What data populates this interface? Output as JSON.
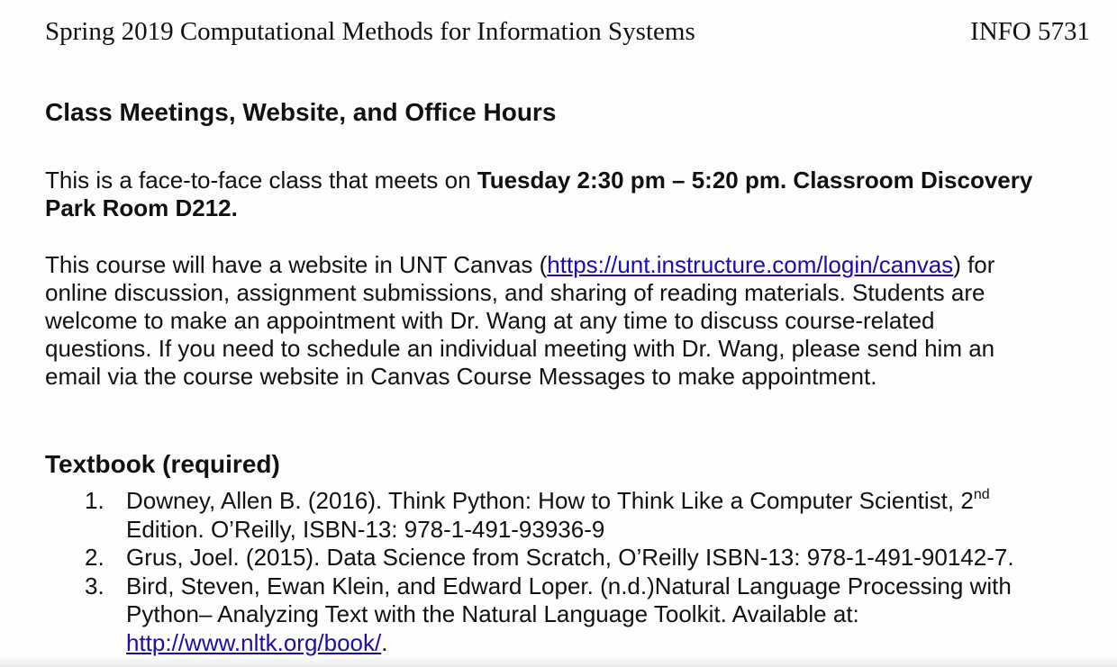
{
  "header": {
    "left": "Spring 2019 Computational Methods for Information Systems",
    "right": "INFO 5731"
  },
  "section_meetings": {
    "heading": "Class Meetings, Website, and Office Hours",
    "p1_lead": "This is a face-to-face class that meets on ",
    "p1_bold_a": "Tuesday 2:30 pm – 5:20 pm. Classroom Discovery",
    "p1_bold_b": "Park Room D212.",
    "p2_start": "This course will have a website in UNT Canvas (",
    "p2_link": "https://unt.instructure.com/login/canvas",
    "p2_after_link": ") for",
    "p2_line2": "online discussion, assignment submissions, and sharing of reading materials. Students are",
    "p2_line3": "welcome to make an appointment with Dr. Wang at any time to discuss course-related",
    "p2_line4": "questions. If you need to schedule an individual meeting with Dr. Wang, please send him an",
    "p2_line5": "email via the course website in Canvas Course Messages to make appointment."
  },
  "section_textbook": {
    "heading": "Textbook (required)",
    "items": [
      {
        "num": "1.",
        "line1": "Downey, Allen B. (2016). Think Python: How to Think Like a Computer Scientist, 2",
        "sup": "nd",
        "line2": "Edition.  O’Reilly, ISBN-13: 978-1-491-93936-9"
      },
      {
        "num": "2.",
        "line1": "Grus, Joel. (2015). Data Science from Scratch, O’Reilly ISBN-13: 978-1-491-90142-7."
      },
      {
        "num": "3.",
        "line1": "Bird, Steven, Ewan Klein, and Edward Loper. (n.d.)Natural Language Processing with",
        "line2": "Python– Analyzing Text with the Natural Language Toolkit. Available at:",
        "link": "http://www.nltk.org/book/",
        "line3_end": "."
      }
    ]
  },
  "colors": {
    "text": "#111111",
    "link": "#1a0dab",
    "background": "#fefefe"
  }
}
